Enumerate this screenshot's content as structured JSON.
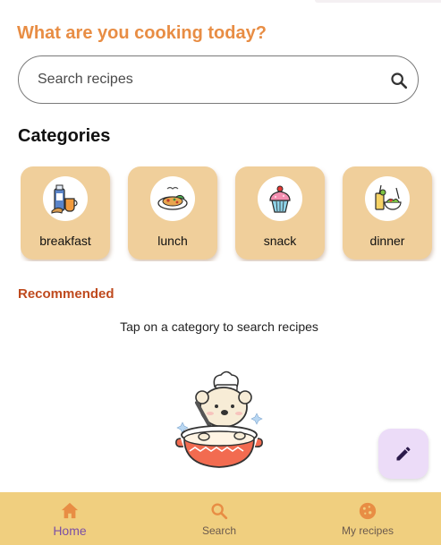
{
  "header": {
    "greeting": "What are you cooking today?"
  },
  "search": {
    "placeholder": "Search recipes",
    "icon": "search-icon"
  },
  "categories": {
    "title": "Categories",
    "items": [
      {
        "label": "breakfast",
        "icon": "breakfast-icon"
      },
      {
        "label": "lunch",
        "icon": "lunch-icon"
      },
      {
        "label": "snack",
        "icon": "cupcake-icon"
      },
      {
        "label": "dinner",
        "icon": "dinner-icon"
      }
    ]
  },
  "recommended": {
    "title": "Recommended",
    "hint": "Tap on a category to search recipes"
  },
  "fab": {
    "icon": "pencil-icon"
  },
  "bottom_nav": {
    "items": [
      {
        "label": "Home",
        "icon": "home-icon",
        "active": true
      },
      {
        "label": "Search",
        "icon": "search-icon",
        "active": false
      },
      {
        "label": "My recipes",
        "icon": "cookie-icon",
        "active": false
      }
    ]
  },
  "colors": {
    "accent": "#e88d44",
    "recommended": "#bf4a1e",
    "card": "#f0cf9b",
    "nav_bg": "#f0cf7f",
    "active_nav": "#7b4fa6",
    "fab_bg": "#ecdcf8"
  }
}
